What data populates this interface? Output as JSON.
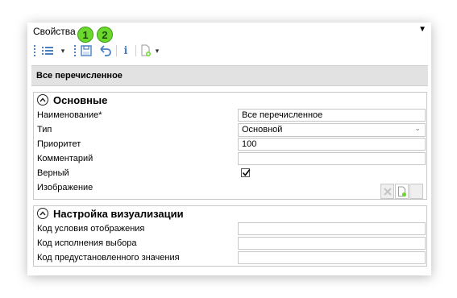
{
  "panel": {
    "title": "Свойства",
    "dropdown_glyph": "▼"
  },
  "toolbar": {
    "items": [
      "list-icon",
      "save-icon",
      "undo-icon",
      "info-icon",
      "new-document-icon"
    ],
    "badges": [
      "1",
      "2"
    ]
  },
  "object_header": "Все перечисленное",
  "groups": [
    {
      "title": "Основные",
      "rows": [
        {
          "label": "Наименование*",
          "value": "Все перечисленное"
        },
        {
          "label": "Тип",
          "value": "Основной"
        },
        {
          "label": "Приоритет",
          "value": "100"
        },
        {
          "label": "Комментарий",
          "value": ""
        },
        {
          "label": "Верный",
          "checked": true
        },
        {
          "label": "Изображение",
          "value": ""
        }
      ]
    },
    {
      "title": "Настройка визуализации",
      "rows": [
        {
          "label": "Код условия отображения",
          "value": ""
        },
        {
          "label": "Код исполнения выбора",
          "value": ""
        },
        {
          "label": "Код предустановленного значения",
          "value": ""
        }
      ]
    }
  ],
  "colors": {
    "accent": "#4a7fc1",
    "badge": "#6cd82e",
    "header_bar": "#e2e2e2"
  }
}
